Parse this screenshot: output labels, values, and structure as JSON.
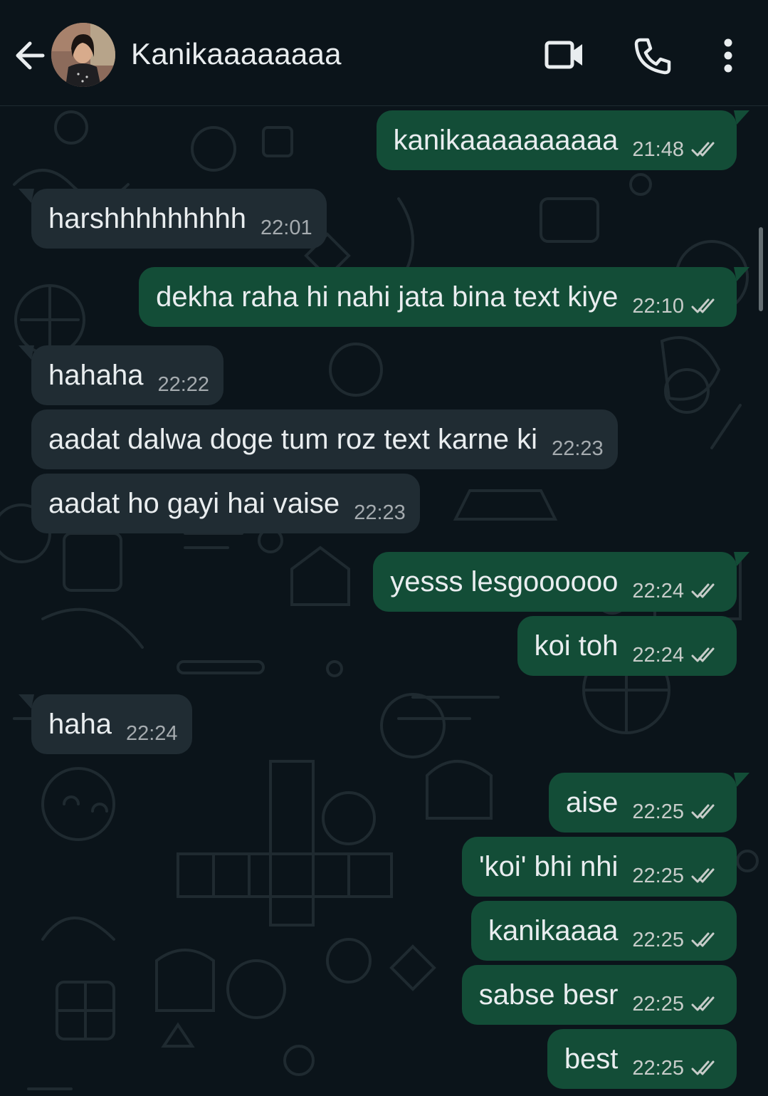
{
  "header": {
    "contact_name": "Kanikaaaaaaaa",
    "icons": [
      "back-arrow-icon",
      "video-call-icon",
      "voice-call-icon",
      "more-options-icon"
    ]
  },
  "messages": [
    {
      "dir": "out",
      "text": "kanikaaaaaaaaaa",
      "time": "21:48",
      "read": true
    },
    {
      "dir": "in",
      "text": "harshhhhhhhhh",
      "time": "22:01"
    },
    {
      "dir": "out",
      "text": "dekha raha hi nahi jata bina text kiye",
      "time": "22:10",
      "read": true
    },
    {
      "dir": "in",
      "text": "hahaha",
      "time": "22:22"
    },
    {
      "dir": "in",
      "text": "aadat dalwa doge tum roz text karne ki",
      "time": "22:23"
    },
    {
      "dir": "in",
      "text": "aadat ho gayi hai vaise",
      "time": "22:23"
    },
    {
      "dir": "out",
      "text": "yesss lesgoooooo",
      "time": "22:24",
      "read": true
    },
    {
      "dir": "out",
      "text": "koi toh",
      "time": "22:24",
      "read": true
    },
    {
      "dir": "in",
      "text": "haha",
      "time": "22:24"
    },
    {
      "dir": "out",
      "text": "aise",
      "time": "22:25",
      "read": true
    },
    {
      "dir": "out",
      "text": "'koi' bhi nhi",
      "time": "22:25",
      "read": true
    },
    {
      "dir": "out",
      "text": "kanikaaaa",
      "time": "22:25",
      "read": true
    },
    {
      "dir": "out",
      "text": "sabse besr",
      "time": "22:25",
      "read": true
    },
    {
      "dir": "out",
      "text": "best",
      "time": "22:25",
      "read": true
    }
  ],
  "colors": {
    "background": "#0b141a",
    "incoming_bubble": "#202c33",
    "outgoing_bubble": "#134d37",
    "text": "#e9edef",
    "read_tick": "#c7ccc9"
  }
}
